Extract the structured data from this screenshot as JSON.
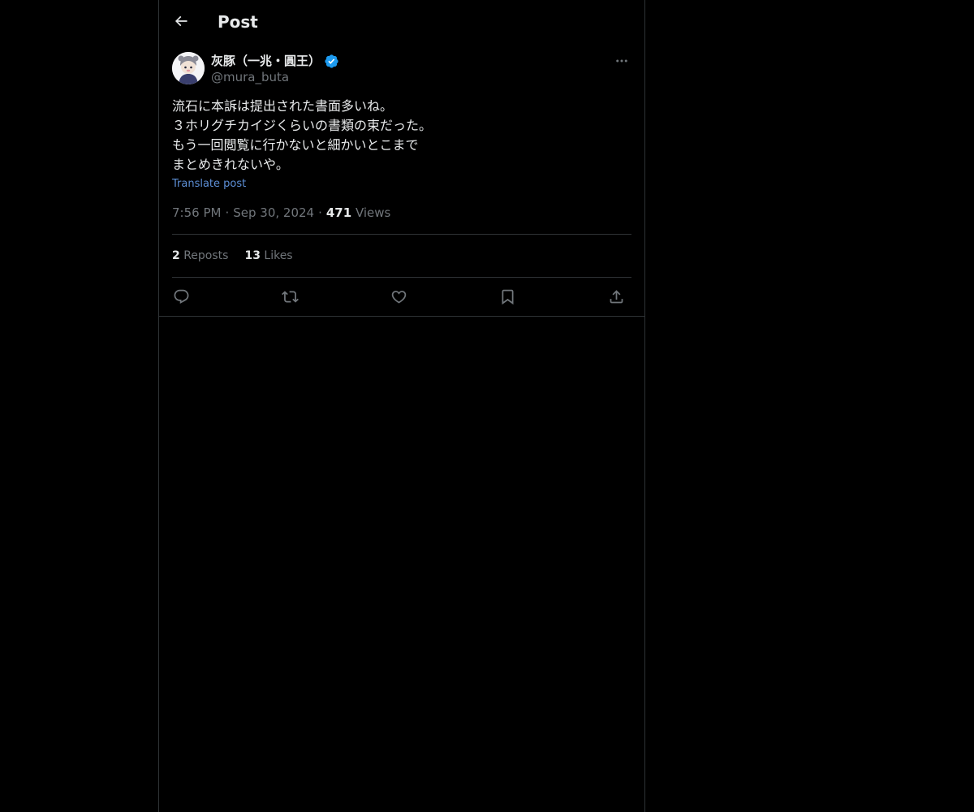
{
  "header": {
    "title": "Post",
    "back_icon": "arrow-left-icon"
  },
  "post": {
    "author": {
      "display_name": "灰豚（一兆・圓王）",
      "handle": "@mura_buta",
      "verified": true,
      "verified_color": "#1d9bf0"
    },
    "text": "流石に本訴は提出された書面多いね。\n３ホリグチカイジくらいの書類の束だった。\nもう一回閲覧に行かないと細かいとこまで\nまとめきれないや。",
    "translate_label": "Translate post",
    "time": "7:56 PM",
    "date": "Sep 30, 2024",
    "views_count": "471",
    "views_label": "Views",
    "separator": "·",
    "stats": {
      "reposts_count": "2",
      "reposts_label": "Reposts",
      "likes_count": "13",
      "likes_label": "Likes"
    },
    "actions": [
      "reply-icon",
      "repost-icon",
      "like-icon",
      "bookmark-icon",
      "share-icon"
    ]
  },
  "colors": {
    "background": "#000000",
    "text": "#e7e9ea",
    "secondary": "#71767b",
    "border": "#2f3336",
    "link": "#5d8fd6"
  }
}
